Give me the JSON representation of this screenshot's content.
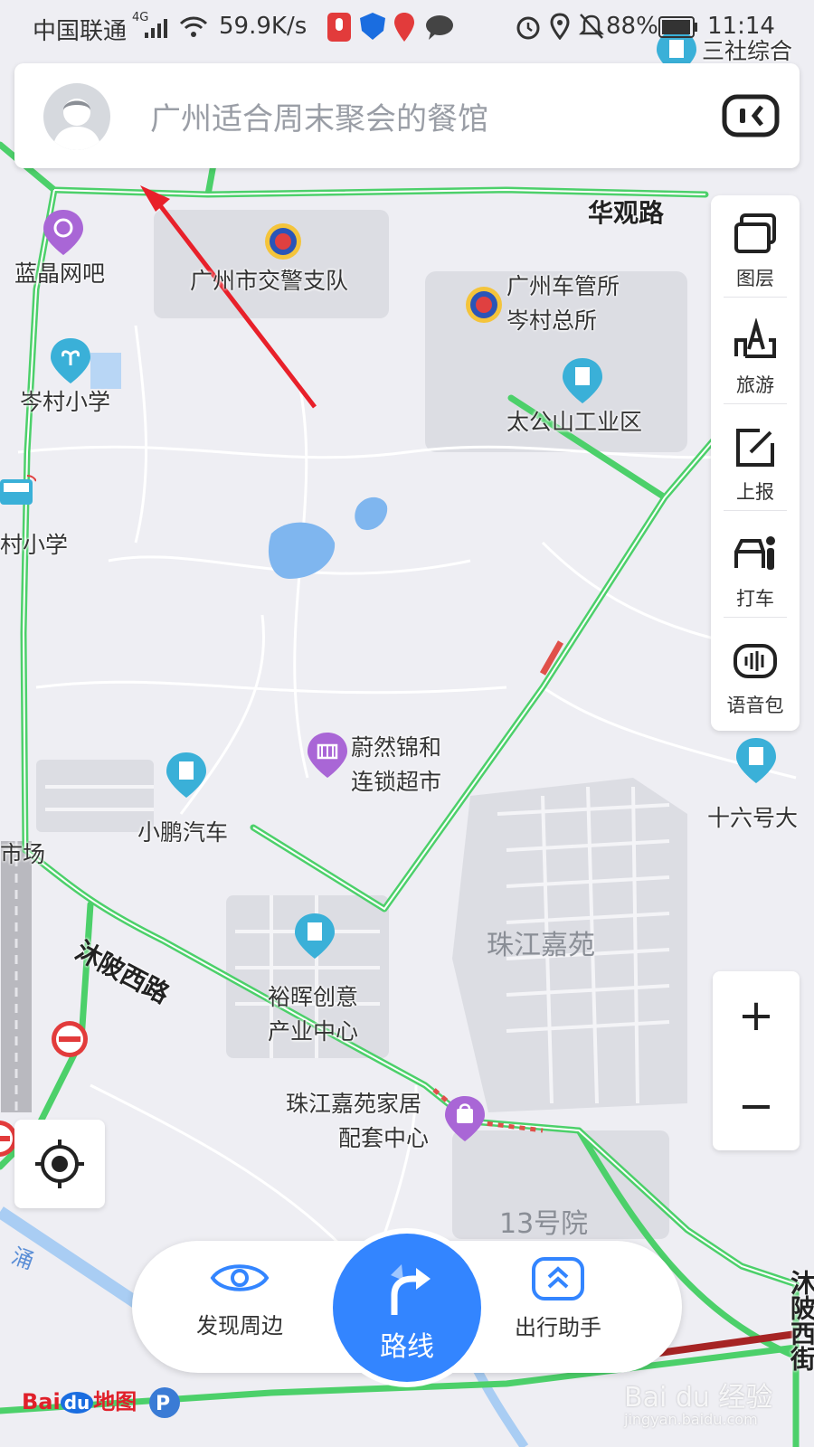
{
  "status_bar": {
    "carrier": "中国联通",
    "network": "4G",
    "speed": "59.9K/s",
    "battery": "88%",
    "time": "11:14"
  },
  "search": {
    "placeholder": "广州适合周末聚会的餐馆"
  },
  "toolbar": {
    "items": [
      {
        "label": "图层",
        "icon": "layers-icon"
      },
      {
        "label": "旅游",
        "icon": "travel-icon"
      },
      {
        "label": "上报",
        "icon": "report-icon"
      },
      {
        "label": "打车",
        "icon": "taxi-icon"
      },
      {
        "label": "语音包",
        "icon": "voice-pack-icon"
      }
    ]
  },
  "zoom": {
    "in": "+",
    "out": "−"
  },
  "bottom_bar": {
    "discover": "发现周边",
    "route": "路线",
    "assistant": "出行助手"
  },
  "map": {
    "roads": [
      "华观路",
      "沐陂西路",
      "沐陂西街"
    ],
    "pois": [
      "三社综合",
      "蓝晶网吧",
      "广州市交警支队",
      "广州车管所",
      "岑村总所",
      "岑村小学",
      "太公山工业区",
      "村小学",
      "蔚然锦和",
      "连锁超市",
      "小鹏汽车",
      "十六号大",
      "市场",
      "裕晖创意",
      "产业中心",
      "珠江嘉苑家居",
      "配套中心"
    ],
    "areas": [
      "珠江嘉苑",
      "13号院",
      "涌"
    ]
  },
  "branding": {
    "logo_left": "Bai",
    "logo_mid": "du",
    "logo_right": "地图",
    "watermark": "Bai du 经验",
    "watermark_url": "jingyan.baidu.com"
  },
  "colors": {
    "traffic_green": "#4cd06a",
    "accent_blue": "#3385ff",
    "annotation_arrow": "#e8202a"
  }
}
